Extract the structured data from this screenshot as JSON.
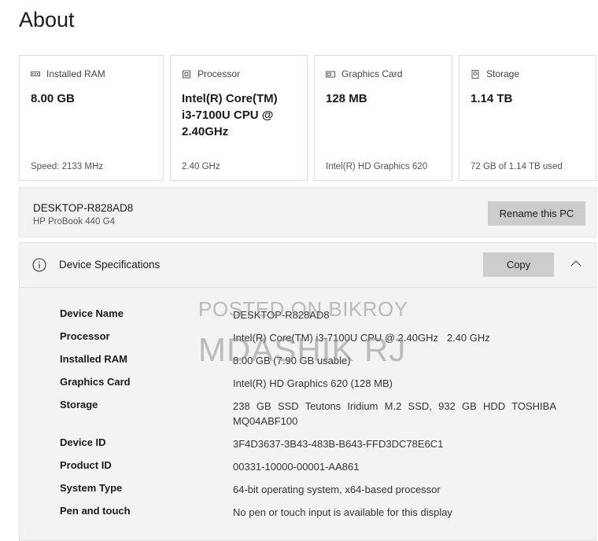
{
  "page": {
    "title": "About"
  },
  "cards": [
    {
      "icon": "ram-icon",
      "label": "Installed RAM",
      "value": "8.00 GB",
      "foot": "Speed: 2133 MHz"
    },
    {
      "icon": "processor-icon",
      "label": "Processor",
      "value": "Intel(R) Core(TM)\ni3-7100U CPU @\n2.40GHz",
      "foot": "2.40 GHz"
    },
    {
      "icon": "graphics-card-icon",
      "label": "Graphics Card",
      "value": "128 MB",
      "foot": "Intel(R) HD Graphics 620"
    },
    {
      "icon": "storage-icon",
      "label": "Storage",
      "value": "1.14 TB",
      "foot": "72 GB of 1.14 TB used"
    }
  ],
  "pc": {
    "name": "DESKTOP-R828AD8",
    "model": "HP ProBook 440 G4",
    "rename_label": "Rename this PC"
  },
  "spec": {
    "title": "Device Specifications",
    "copy_label": "Copy",
    "rows": [
      {
        "label": "Device Name",
        "value": "DESKTOP-R828AD8"
      },
      {
        "label": "Processor",
        "value": "Intel(R) Core(TM) i3-7100U CPU @ 2.40GHz   2.40 GHz"
      },
      {
        "label": "Installed RAM",
        "value": "8.00 GB (7.90 GB usable)"
      },
      {
        "label": "Graphics Card",
        "value": "Intel(R) HD Graphics 620 (128 MB)"
      },
      {
        "label": "Storage",
        "value": "238 GB SSD Teutons Iridium M.2 SSD, 932 GB HDD TOSHIBA MQ04ABF100"
      },
      {
        "label": "Device ID",
        "value": "3F4D3637-3B43-483B-B643-FFD3DC78E6C1"
      },
      {
        "label": "Product ID",
        "value": "00331-10000-00001-AA861"
      },
      {
        "label": "System Type",
        "value": "64-bit operating system, x64-based processor"
      },
      {
        "label": "Pen and touch",
        "value": "No pen or touch input is available for this display"
      }
    ]
  },
  "watermark": {
    "line1": "POSTED ON BIKROY",
    "line2": "MDASHIK RJ"
  }
}
